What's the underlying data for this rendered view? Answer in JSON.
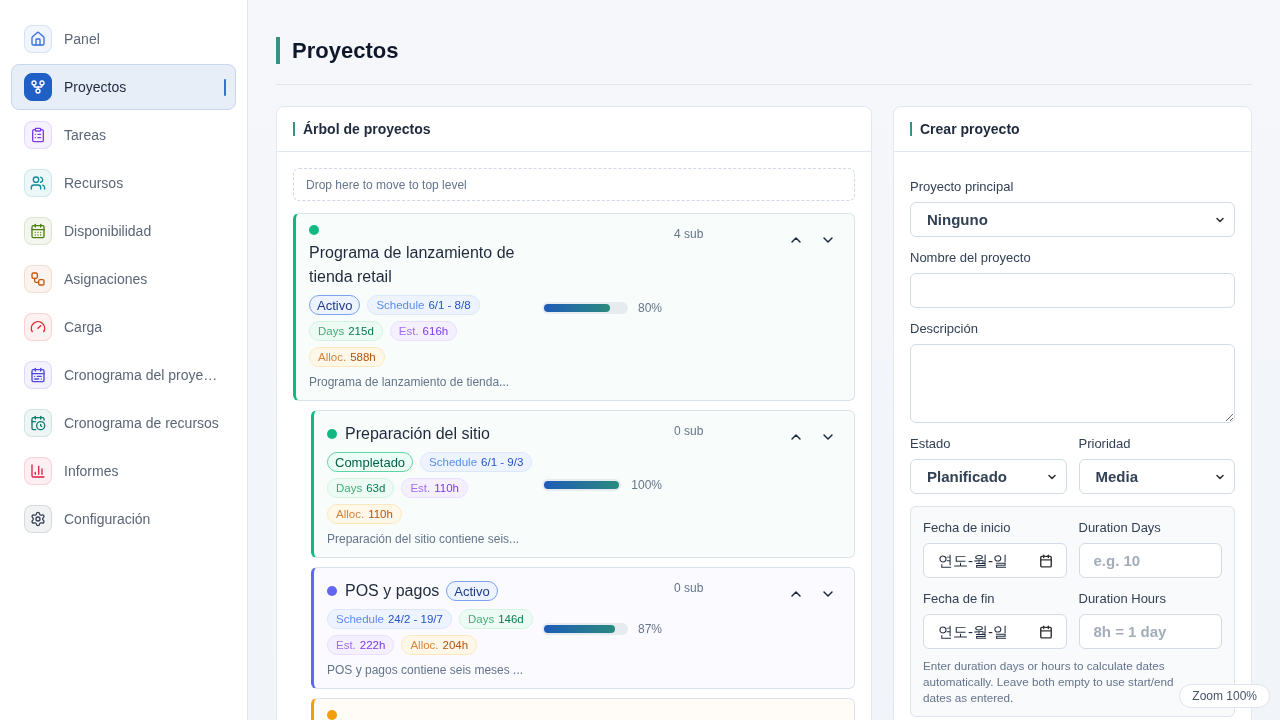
{
  "sidebar": {
    "items": [
      {
        "label": "Panel",
        "color": "#3b6fd8",
        "selected": false
      },
      {
        "label": "Proyectos",
        "color": "#1f5fc6",
        "selected": true
      },
      {
        "label": "Tareas",
        "color": "#7c3aed",
        "selected": false
      },
      {
        "label": "Recursos",
        "color": "#0e8a9a",
        "selected": false
      },
      {
        "label": "Disponibilidad",
        "color": "#4d7c0f",
        "selected": false
      },
      {
        "label": "Asignaciones",
        "color": "#c2570c",
        "selected": false
      },
      {
        "label": "Carga",
        "color": "#dc2626",
        "selected": false
      },
      {
        "label": "Cronograma del proye…",
        "color": "#4f46e5",
        "selected": false
      },
      {
        "label": "Cronograma de recursos",
        "color": "#0f766e",
        "selected": false
      },
      {
        "label": "Informes",
        "color": "#e11d48",
        "selected": false
      },
      {
        "label": "Configuración",
        "color": "#334155",
        "selected": false
      }
    ]
  },
  "page": {
    "title": "Proyectos"
  },
  "tree": {
    "title": "Árbol de proyectos",
    "drop_zone": "Drop here to move to top level",
    "projects": [
      {
        "title": "Programa de lanzamiento de tienda retail",
        "color": "#10b981",
        "status": {
          "kind": "active",
          "label": "Activo"
        },
        "badges": [
          {
            "kind": "schedule",
            "label": "Schedule",
            "value": "6/1 - 8/8"
          },
          {
            "kind": "days",
            "label": "Days",
            "value": "215d"
          },
          {
            "kind": "estimate",
            "label": "Est.",
            "value": "616h"
          },
          {
            "kind": "allocation",
            "label": "Alloc.",
            "value": "588h"
          }
        ],
        "progress": {
          "level": 0.8,
          "label": "80%"
        },
        "sub_count": "4 sub",
        "description": "Programa de lanzamiento de tienda...",
        "children": [
          {
            "title": "Preparación del sitio",
            "color": "#10b981",
            "status": {
              "kind": "completed",
              "label": "Completado"
            },
            "badges": [
              {
                "kind": "schedule",
                "label": "Schedule",
                "value": "6/1 - 9/3"
              },
              {
                "kind": "days",
                "label": "Days",
                "value": "63d"
              },
              {
                "kind": "estimate",
                "label": "Est.",
                "value": "110h"
              },
              {
                "kind": "allocation",
                "label": "Alloc.",
                "value": "110h"
              }
            ],
            "progress": {
              "level": 1,
              "label": "100%"
            },
            "sub_count": "0 sub",
            "description": "Preparación del sitio contiene seis..."
          },
          {
            "title": "POS y pagos",
            "color": "#6366f1",
            "status": {
              "kind": "active",
              "label": "Activo"
            },
            "badges": [
              {
                "kind": "schedule",
                "label": "Schedule",
                "value": "24/2 - 19/7"
              },
              {
                "kind": "days",
                "label": "Days",
                "value": "146d"
              },
              {
                "kind": "estimate",
                "label": "Est.",
                "value": "222h"
              },
              {
                "kind": "allocation",
                "label": "Alloc.",
                "value": "204h"
              }
            ],
            "progress": {
              "level": 0.87,
              "label": "87%"
            },
            "sub_count": "0 sub",
            "description": "POS y pagos contiene seis meses ..."
          },
          {
            "color": "#f59e0b"
          }
        ]
      }
    ]
  },
  "form": {
    "title": "Crear proyecto",
    "parent_project": {
      "label": "Proyecto principal",
      "value": "Ninguno"
    },
    "name": {
      "label": "Nombre del proyecto"
    },
    "description": {
      "label": "Descripción"
    },
    "status": {
      "label": "Estado",
      "value": "Planificado"
    },
    "priority": {
      "label": "Prioridad",
      "value": "Media"
    },
    "schedule": {
      "start_date": {
        "label": "Fecha de inicio",
        "placeholder": "연도-월-일"
      },
      "duration_days": {
        "label": "Duration Days",
        "placeholder": "e.g. 10"
      },
      "end_date": {
        "label": "Fecha de fin",
        "placeholder": "연도-월-일"
      },
      "duration_hours": {
        "label": "Duration Hours",
        "placeholder": "8h = 1 day"
      },
      "help": "Enter duration days or hours to calculate dates automatically. Leave both empty to use start/end dates as entered."
    }
  },
  "zoom_indicator": {
    "label": "Zoom 100%"
  }
}
